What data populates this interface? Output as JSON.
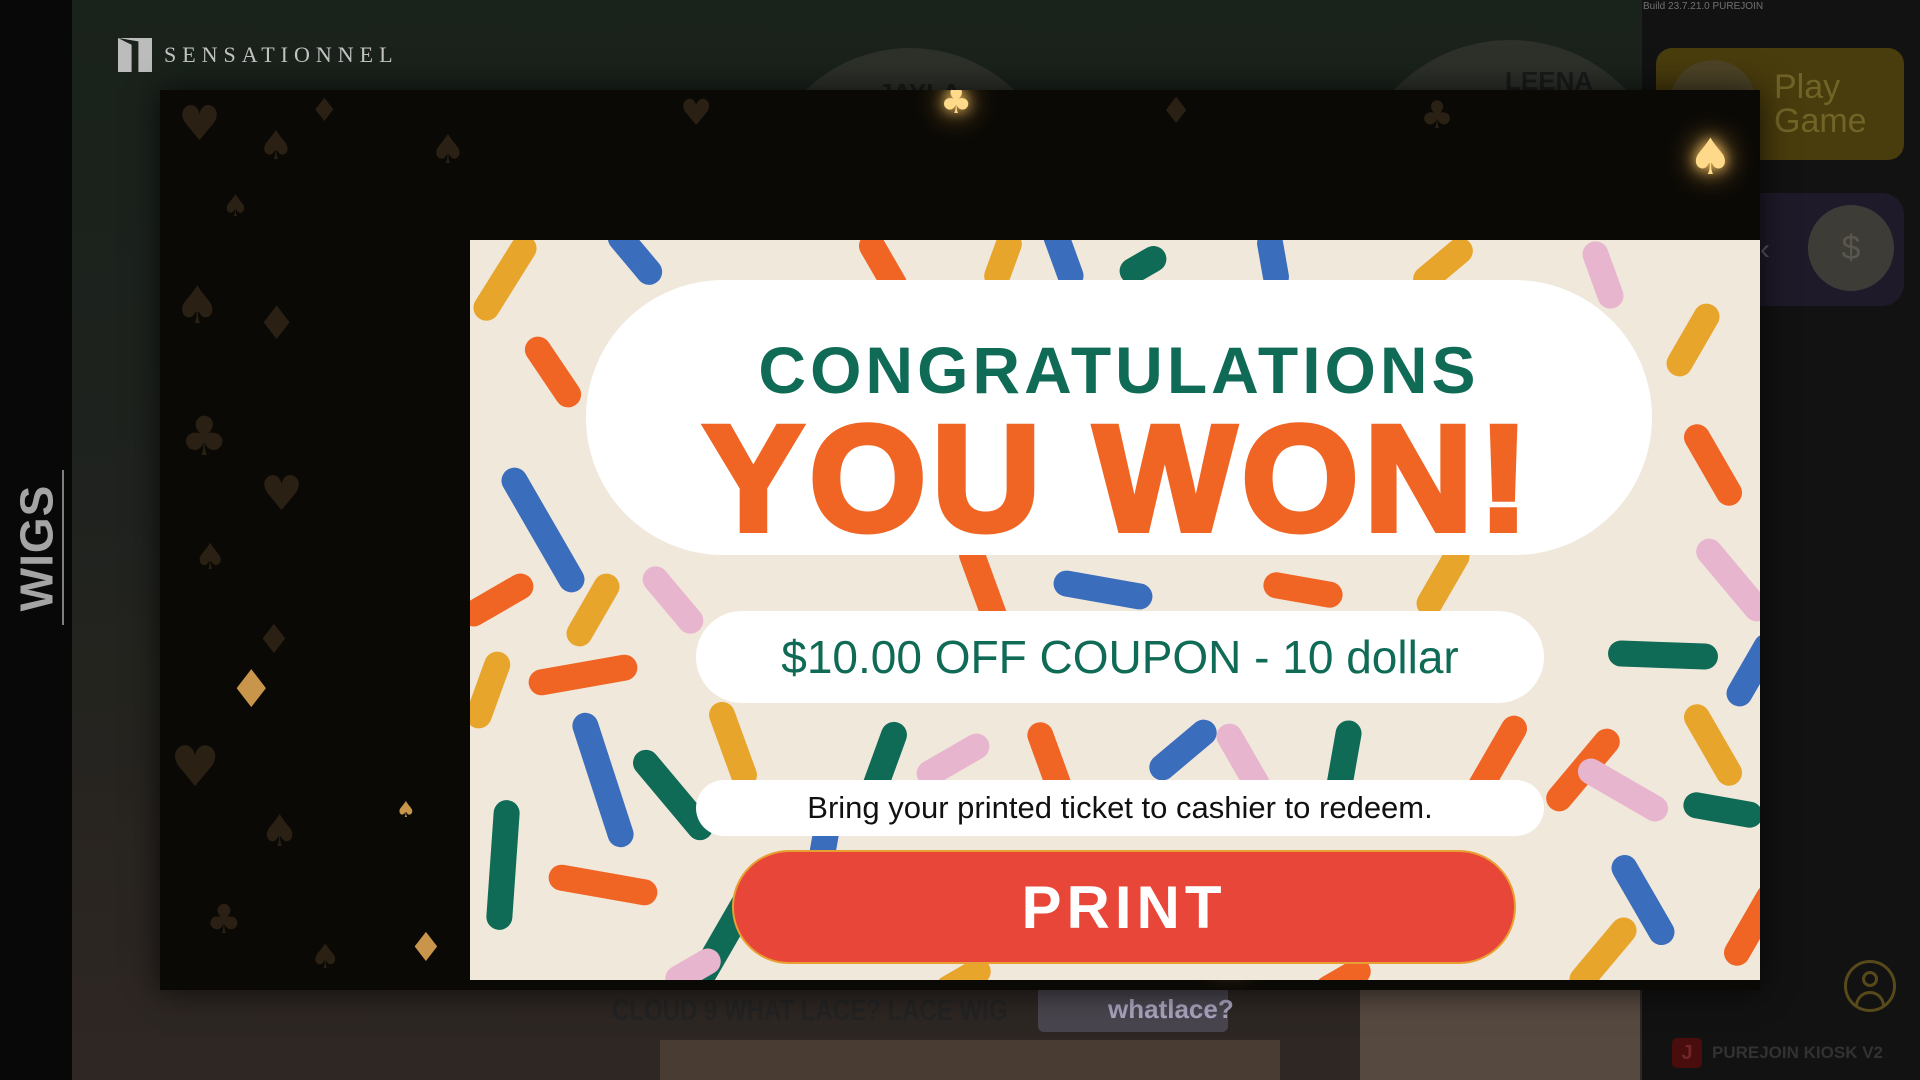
{
  "background": {
    "side_tab": "WIGS",
    "brand": "SENSATIONNEL",
    "models": [
      "JAYLA",
      "LEENA"
    ],
    "product_title": "CLOUD 9 WHAT LACE? LACE WIG",
    "product_logo": "whatlace?"
  },
  "right_panel": {
    "build": "Build 23.7.21.0 PUREJOIN",
    "play_game_label": "Play Game",
    "kiosk_brand": "PUREJOIN KIOSK V2"
  },
  "modal": {
    "headline": "CONGRATULATIONS",
    "subheadline": "YOU WON!",
    "prize": "$10.00 OFF COUPON - 10 dollar",
    "instruction": "Bring your printed ticket to cashier to redeem.",
    "print_label": "PRINT"
  },
  "icons": [
    "spade-icon",
    "heart-icon",
    "diamond-icon",
    "club-icon",
    "user-icon",
    "cash-icon",
    "chevron-left-icon",
    "game-controller-icon"
  ],
  "colors": {
    "green": "#0f6b55",
    "orange": "#f06524",
    "print_red": "#e84638",
    "coupon_bg": "#f1e8dc"
  }
}
